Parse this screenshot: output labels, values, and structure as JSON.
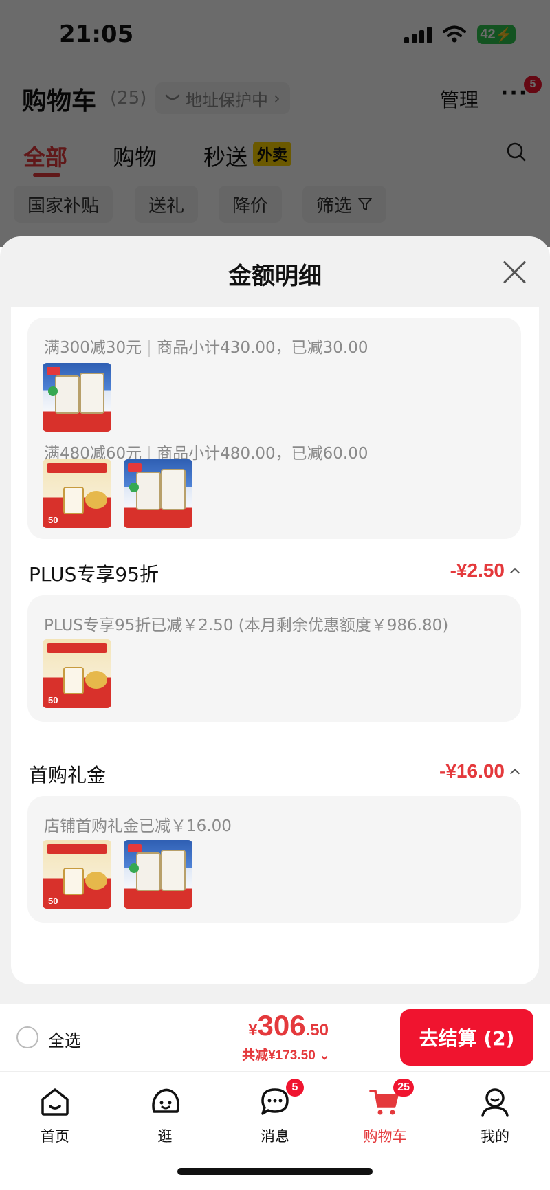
{
  "status_bar": {
    "time": "21:05",
    "battery": "42"
  },
  "header": {
    "title": "购物车",
    "count": "(25)",
    "address": "地址保护中",
    "manage": "管理",
    "more_badge": "5"
  },
  "tabs": [
    {
      "label": "全部"
    },
    {
      "label": "购物"
    },
    {
      "label": "秒送"
    }
  ],
  "takeaway_tag": "外卖",
  "filter_chips": [
    "国家补贴",
    "送礼",
    "降价",
    "筛选"
  ],
  "sheet": {
    "title": "金额明细",
    "promo_card": {
      "line1": {
        "rule": "满300减30元",
        "detail": "商品小计430.00，已减30.00"
      },
      "line2": {
        "rule": "满480减60元",
        "detail": "商品小计480.00，已减60.00"
      }
    },
    "plus": {
      "label": "PLUS专享95折",
      "amount": "-¥2.50",
      "note": "PLUS专享95折已减￥2.50 (本月剩余优惠额度￥986.80)"
    },
    "first_gift": {
      "label": "首购礼金",
      "amount": "-¥16.00",
      "note": "店铺首购礼金已减￥16.00"
    },
    "thumb_text": "50"
  },
  "checkout": {
    "select_all": "全选",
    "currency": "¥",
    "total_int": "306",
    "total_dec": ".50",
    "saved": "共减¥173.50",
    "pay_button": "去结算 (2)"
  },
  "tabbar": {
    "items": [
      {
        "label": "首页"
      },
      {
        "label": "逛"
      },
      {
        "label": "消息",
        "badge": "5"
      },
      {
        "label": "购物车",
        "badge": "25"
      },
      {
        "label": "我的"
      }
    ]
  },
  "colors": {
    "accent": "#e4393c",
    "button": "#f0142f",
    "takeaway": "#ffd400"
  }
}
